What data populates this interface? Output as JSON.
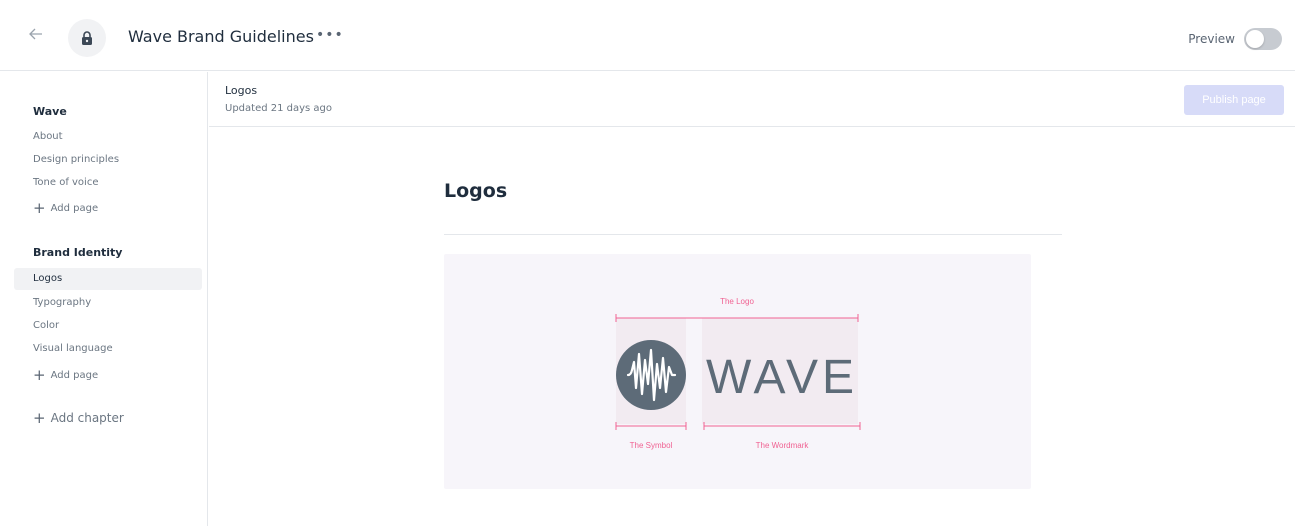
{
  "header": {
    "title": "Wave Brand Guidelines",
    "more": "•••",
    "back_icon": "arrow-left-icon",
    "lock_icon": "lock-icon",
    "preview_label": "Preview",
    "preview_enabled": false
  },
  "sidebar": {
    "chapters": [
      {
        "title": "Wave",
        "items": [
          "About",
          "Design principles",
          "Tone of voice"
        ],
        "add_page": "Add page"
      },
      {
        "title": "Brand Identity",
        "items": [
          "Logos",
          "Typography",
          "Color",
          "Visual language"
        ],
        "add_page": "Add page",
        "active": "Logos"
      }
    ],
    "add_chapter": "Add chapter"
  },
  "page_header": {
    "name": "Logos",
    "updated": "Updated 21 days ago",
    "publish_label": "Publish page",
    "publish_color": "#d7dbf8"
  },
  "content": {
    "title": "Logos",
    "diagram": {
      "logo_label": "The Logo",
      "symbol_label": "The Symbol",
      "wordmark_label": "The Wordmark",
      "wordmark_text": "WAVE",
      "accent_color": "#f06292",
      "mark_color": "#5d6b78"
    }
  }
}
